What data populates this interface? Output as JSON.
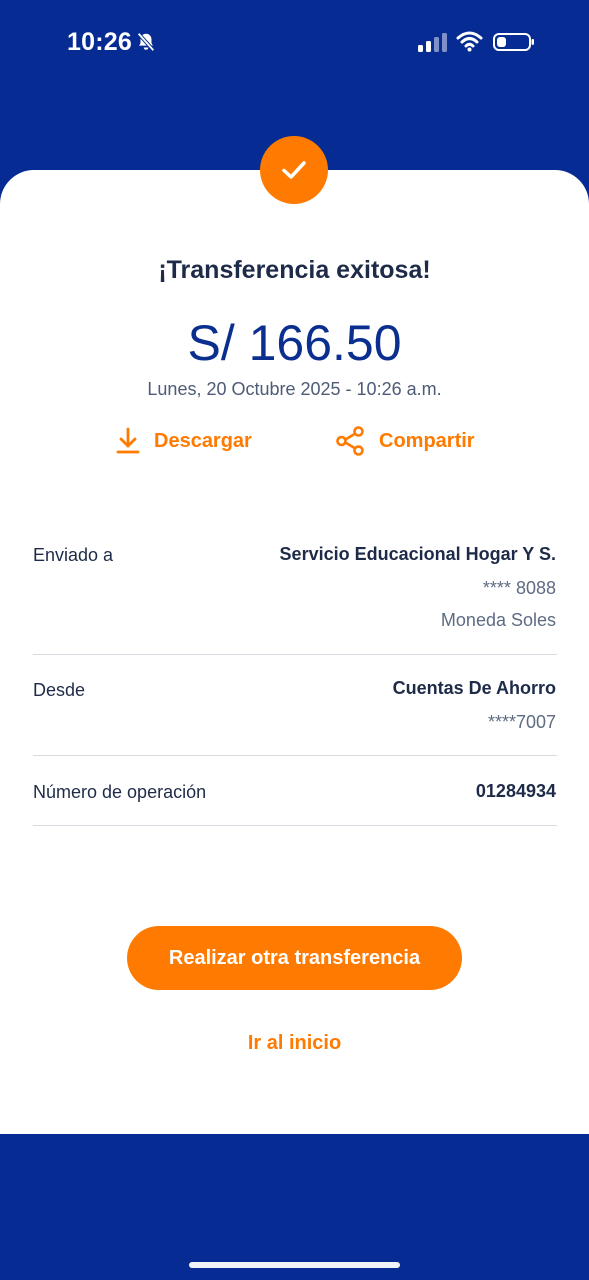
{
  "status_bar": {
    "time": "10:26",
    "icons": [
      "bell-slash-icon",
      "signal-icon",
      "wifi-icon",
      "battery-icon"
    ]
  },
  "receipt": {
    "title": "¡Transferencia exitosa!",
    "amount": "S/ 166.50",
    "datetime": "Lunes, 20 Octubre 2025 - 10:26 a.m."
  },
  "actions": {
    "download_label": "Descargar",
    "share_label": "Compartir"
  },
  "details": {
    "sent_to": {
      "label": "Enviado a",
      "name": "Servicio Educacional Hogar Y S.",
      "account": "**** 8088",
      "currency": "Moneda Soles"
    },
    "from": {
      "label": "Desde",
      "account_type": "Cuentas De Ahorro",
      "account": "****7007"
    },
    "operation": {
      "label": "Número de operación",
      "number": "01284934"
    }
  },
  "buttons": {
    "new_transfer": "Realizar otra transferencia",
    "go_home": "Ir al inicio"
  },
  "colors": {
    "brand_blue": "#062b93",
    "accent_orange": "#ff7a00",
    "text_dark": "#1e2b48"
  }
}
